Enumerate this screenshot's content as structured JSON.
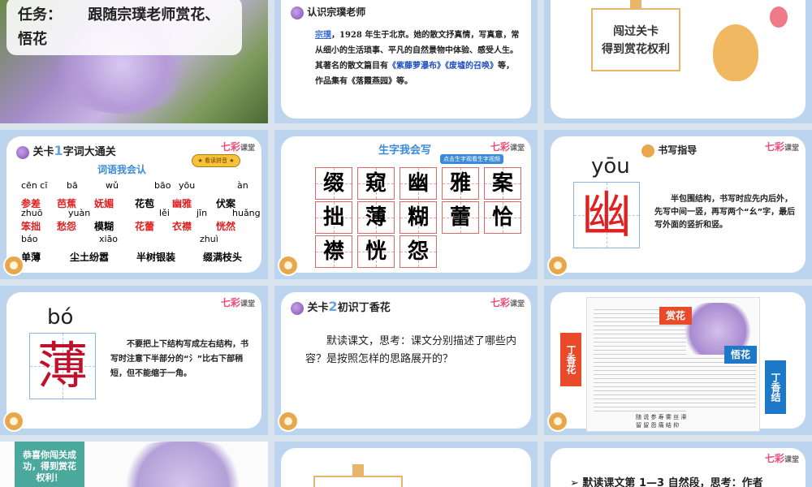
{
  "slide1": {
    "task_label": "任务：",
    "task_text": "跟随宗璞老师赏花、悟花"
  },
  "slide2": {
    "title": "认识宗璞老师",
    "name": "宗璞",
    "body_a": "，1928 年生于北京。她的散文抒真情，写真意，常从细小的生活琐事、平凡的自然景物中体验、感受人生。其著名的散文篇目有",
    "work1": "《紫藤萝瀑布》",
    "work2": "《废墟的召唤》",
    "body_b": "等，作品集有《落霞燕园》等。"
  },
  "slide3": {
    "line1": "闯过关卡",
    "line2": "得到赏花权利"
  },
  "brand": {
    "name": "七彩",
    "sub": "课堂"
  },
  "slide4": {
    "level": "关卡",
    "level_num": "1",
    "title": "字词大通关",
    "subtitle": "词语我会认",
    "button": "★ 看读拼音 ★",
    "row1_pinyin": [
      "cēn cī",
      "bā",
      "wǔ",
      "bāo",
      "yōu",
      "àn"
    ],
    "row1": [
      "参差",
      "芭蕉",
      "妩媚",
      "花苞",
      "幽雅",
      "伏案"
    ],
    "row2_pinyin": [
      "zhuō",
      "yuàn",
      "",
      "lěi",
      "jīn",
      "huǎng"
    ],
    "row2": [
      "笨拙",
      "愁怨",
      "模糊",
      "花蕾",
      "衣襟",
      "恍然"
    ],
    "row3_pinyin": [
      "báo",
      "xiāo",
      "",
      "zhuì"
    ],
    "row3": [
      "单薄",
      "尘土纷嚣",
      "半树银装",
      "缀满枝头"
    ]
  },
  "slide5": {
    "title": "生字我会写",
    "hint": "点击生字观看生字视频",
    "chars": [
      "缀",
      "窥",
      "幽",
      "雅",
      "案",
      "拙",
      "薄",
      "糊",
      "蕾",
      "恰",
      "襟",
      "恍",
      "怨"
    ]
  },
  "slide6": {
    "title": "书写指导",
    "pinyin": "yōu",
    "char": "幽",
    "text": "半包围结构，书写时应先内后外，先写中间一竖，再写两个“幺”字，最后写外面的竖折和竖。"
  },
  "slide7": {
    "pinyin": "bó",
    "char": "薄",
    "text": "不要把上下结构写成左右结构，书写时注意下半部分的“氵”比右下部稍短，但不能缩于一角。"
  },
  "slide8": {
    "level": "关卡",
    "level_num": "2",
    "title": "初识丁香花",
    "text": "默读课文，思考：课文分别描述了哪些内容？是按照怎样的思路展开的？"
  },
  "slide9": {
    "tag_left": "丁香花",
    "tag_mid": "赏花",
    "tag_wu": "悟花",
    "tag_right": "丁香结",
    "footer1": "随 说 参 寿 雾 丝 滞",
    "footer2": "留 留 怨 痛 结 抑"
  },
  "slide10": {
    "text": "恭喜你闯关成功，得到赏花权利！"
  },
  "slide12": {
    "text": "默读课文第 1—3 自然段，思考：作者"
  }
}
